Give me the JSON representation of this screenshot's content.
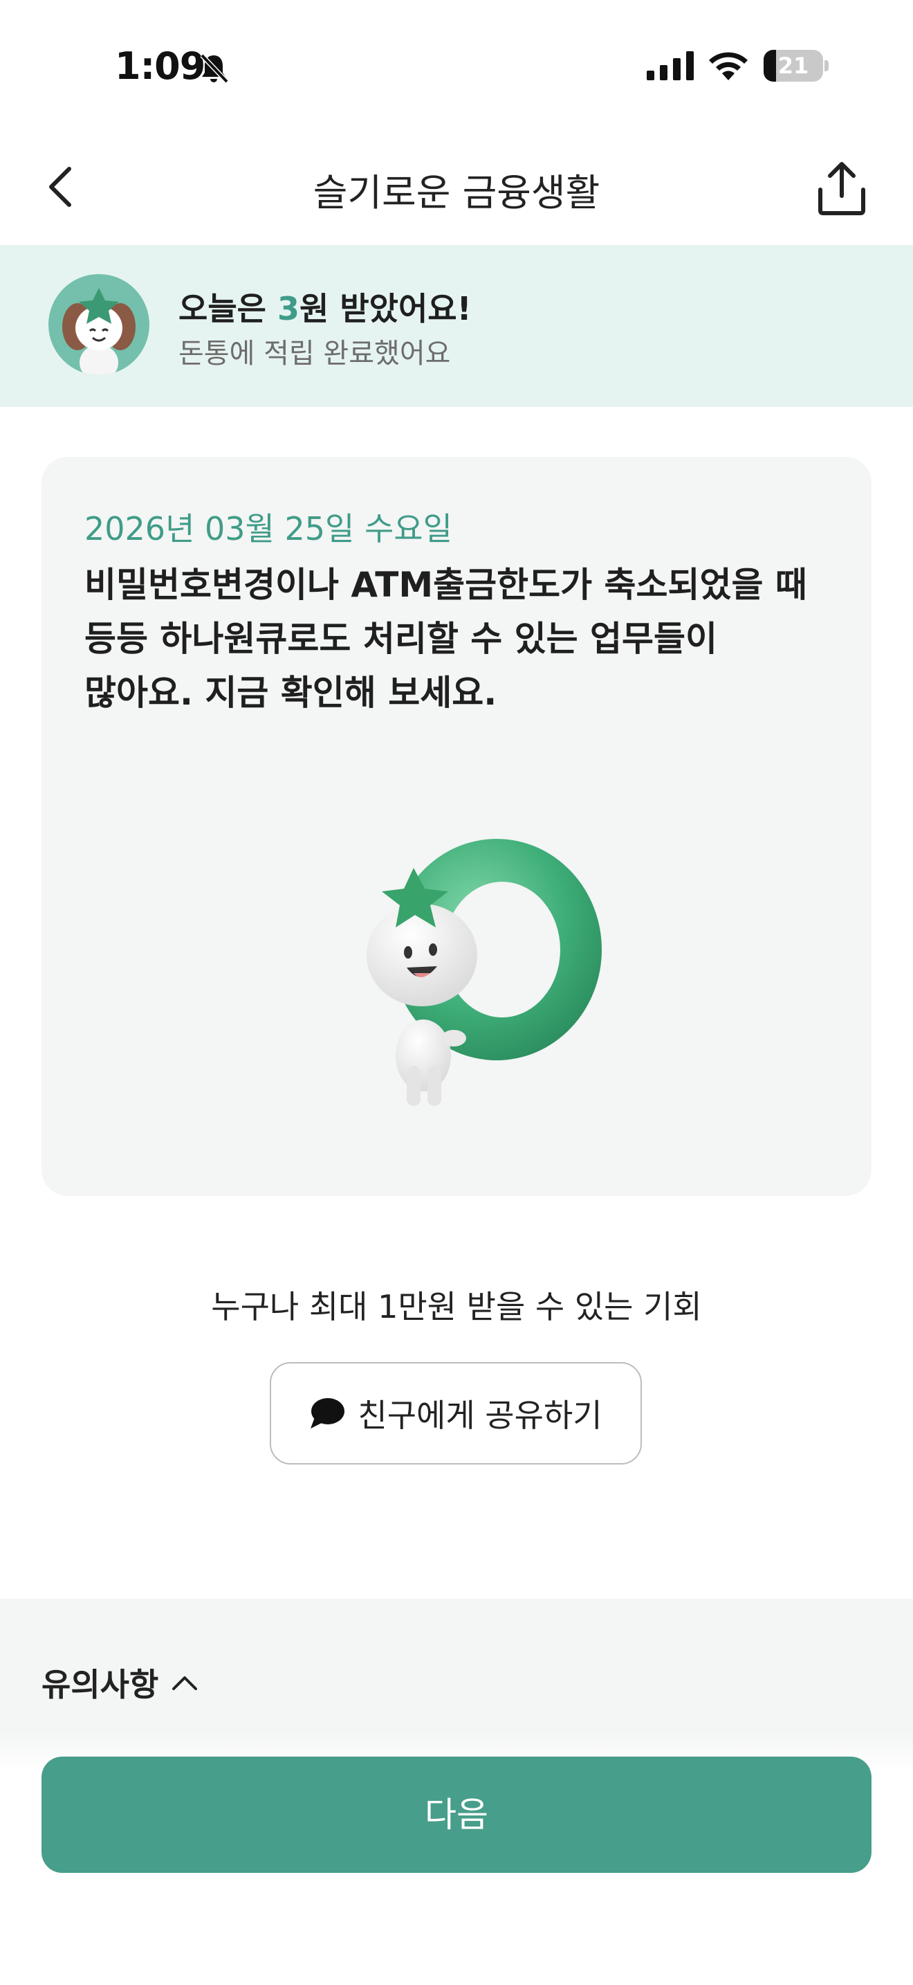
{
  "status_bar": {
    "time": "1:09",
    "battery_level": "21",
    "battery_fraction": 0.21
  },
  "nav": {
    "title": "슬기로운 금융생활"
  },
  "reward": {
    "prefix": "오늘은 ",
    "amount": "3",
    "suffix": "원 받았어요!",
    "subtitle": "돈통에 적립 완료했어요"
  },
  "card": {
    "date": "2026년 03월 25일 수요일",
    "lines": [
      "비밀번호변경이나 ATM출금한도가 축소되었을 때",
      "등등 하나원큐로도 처리할 수 있는 업무들이",
      "많아요. 지금 확인해 보세요."
    ]
  },
  "invite": {
    "text": "누구나 최대 1만원 받을 수 있는 기회",
    "button_label": "친구에게 공유하기"
  },
  "notice": {
    "label": "유의사항"
  },
  "footer": {
    "next_label": "다음"
  },
  "colors": {
    "accent": "#3f9c88",
    "button": "#479e8a",
    "banner_bg": "#e6f4f1",
    "card_bg": "#f4f5f5"
  },
  "icons": {
    "back": "chevron-left-icon",
    "share": "share-upload-icon",
    "chat": "chat-bubble-icon",
    "notice_toggle": "chevron-up-icon",
    "bell": "bell-slash-icon"
  }
}
